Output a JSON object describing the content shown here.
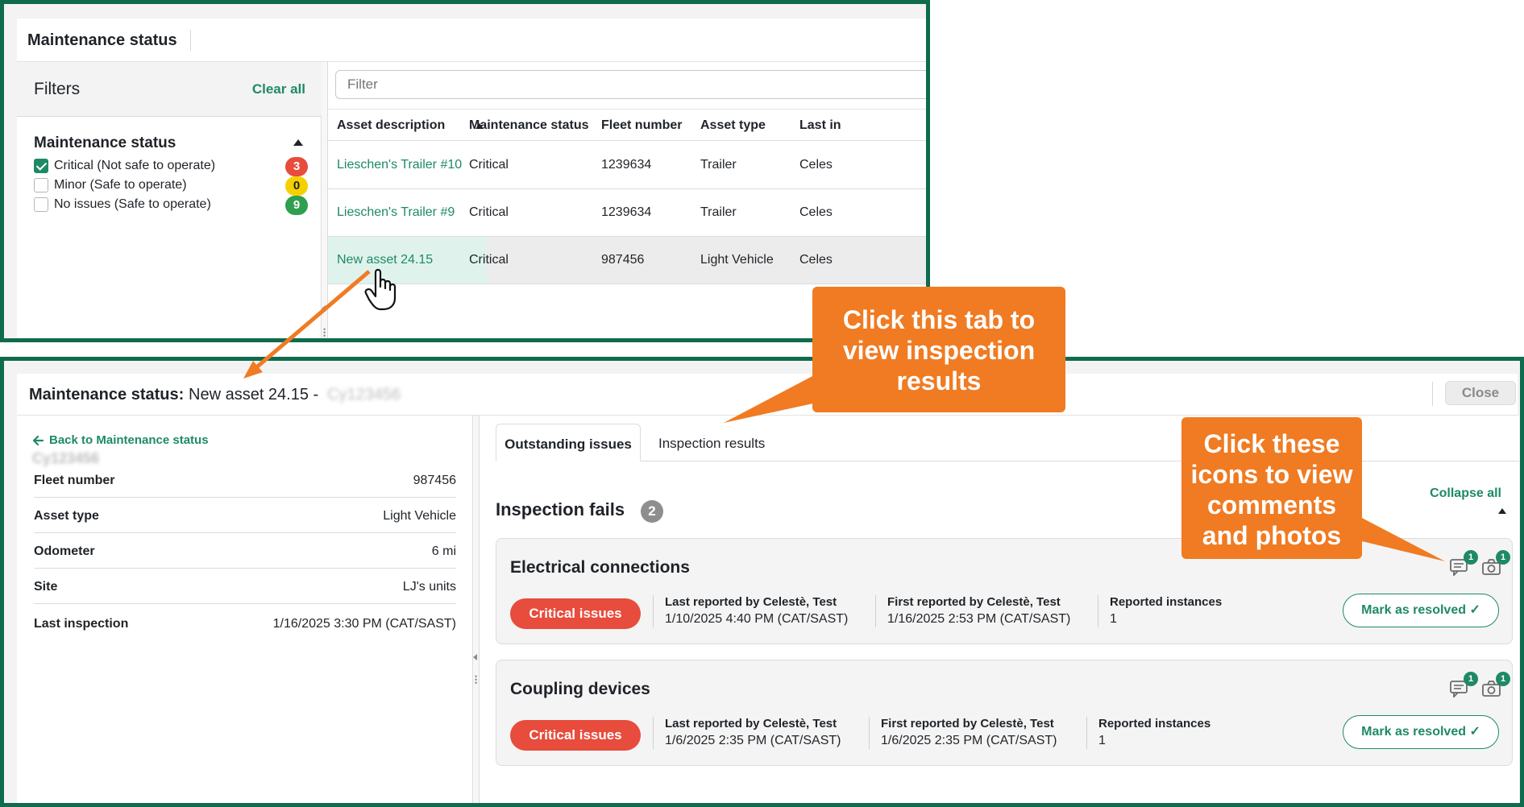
{
  "top_panel": {
    "title": "Maintenance status",
    "filters": {
      "heading": "Filters",
      "clear_all": "Clear all",
      "section_title": "Maintenance status",
      "options": [
        {
          "label": "Critical (Not safe to operate)",
          "count": "3",
          "checked": true,
          "color": "#e74c3c"
        },
        {
          "label": "Minor (Safe to operate)",
          "count": "0",
          "checked": false,
          "color": "#f5d000"
        },
        {
          "label": "No issues (Safe to operate)",
          "count": "9",
          "checked": false,
          "color": "#2e9e4f"
        }
      ]
    },
    "grid": {
      "filter_placeholder": "Filter",
      "columns": [
        "Asset description",
        "Maintenance status",
        "Fleet number",
        "Asset type",
        "Last in"
      ],
      "rows": [
        {
          "asset": "Lieschen's Trailer #10",
          "status": "Critical",
          "fleet": "1239634",
          "type": "Trailer",
          "last": "Celes"
        },
        {
          "asset": "Lieschen's Trailer #9",
          "status": "Critical",
          "fleet": "1239634",
          "type": "Trailer",
          "last": "Celes"
        },
        {
          "asset": "New asset 24.15",
          "status": "Critical",
          "fleet": "987456",
          "type": "Light Vehicle",
          "last": "Celes"
        }
      ]
    }
  },
  "detail": {
    "title_label": "Maintenance status:",
    "title_value": "New asset 24.15 -",
    "title_blurred": "Cy123456",
    "close_label": "Close",
    "back_label": "Back to Maintenance status",
    "asset_id_blurred": "Cy123456",
    "fields": [
      {
        "key": "Fleet number",
        "value": "987456"
      },
      {
        "key": "Asset type",
        "value": "Light Vehicle"
      },
      {
        "key": "Odometer",
        "value": "6 mi"
      },
      {
        "key": "Site",
        "value": "LJ's units"
      },
      {
        "key": "Last inspection",
        "value": "1/16/2025 3:30 PM (CAT/SAST)"
      }
    ],
    "tabs": [
      "Outstanding issues",
      "Inspection results"
    ],
    "collapse_all": "Collapse all",
    "section_title": "Inspection fails",
    "section_count": "2",
    "cards": [
      {
        "title": "Electrical connections",
        "pill": "Critical issues",
        "last_reported_label": "Last reported by Celestè, Test",
        "last_reported_value": "1/10/2025 4:40 PM (CAT/SAST)",
        "first_reported_label": "First reported by Celestè, Test",
        "first_reported_value": "1/16/2025 2:53 PM (CAT/SAST)",
        "instances_label": "Reported instances",
        "instances_value": "1",
        "comments_count": "1",
        "photos_count": "1",
        "resolve_label": "Mark as resolved ✓"
      },
      {
        "title": "Coupling devices",
        "pill": "Critical issues",
        "last_reported_label": "Last reported by Celestè, Test",
        "last_reported_value": "1/6/2025 2:35 PM (CAT/SAST)",
        "first_reported_label": "First reported by Celestè, Test",
        "first_reported_value": "1/6/2025 2:35 PM (CAT/SAST)",
        "instances_label": "Reported instances",
        "instances_value": "1",
        "comments_count": "1",
        "photos_count": "1",
        "resolve_label": "Mark as resolved ✓"
      }
    ]
  },
  "callouts": {
    "tab": "Click this tab to view inspection results",
    "icons": "Click these icons to view comments and photos"
  },
  "colors": {
    "frame": "#0f6b4d",
    "accent": "#1e8a65",
    "callout": "#f07b22",
    "critical": "#e74c3c"
  }
}
